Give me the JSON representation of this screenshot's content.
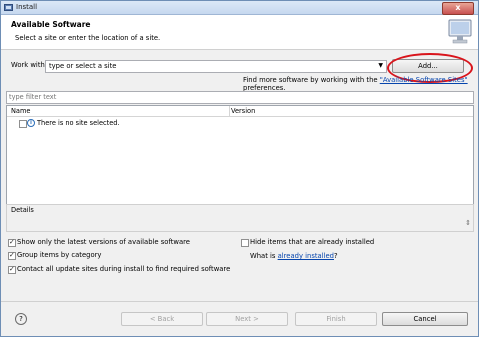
{
  "window": {
    "title": "Install",
    "close_glyph": "x"
  },
  "banner": {
    "heading": "Available Software",
    "subtitle": "Select a site or enter the location of a site."
  },
  "work_with": {
    "label": "Work with:",
    "value": "type or select a site",
    "add_label": "Add...",
    "more_prefix": "Find more software by working with the ",
    "more_link": "\"Available Software Sites\"",
    "more_suffix": " preferences."
  },
  "filter": {
    "placeholder": "type filter text"
  },
  "table": {
    "columns": [
      "Name",
      "Version"
    ],
    "rows": [
      {
        "name": "There is no site selected.",
        "version": ""
      }
    ]
  },
  "details": {
    "label": "Details",
    "scroll_glyph": "⇕"
  },
  "options": {
    "latest_only": {
      "label": "Show only the latest versions of available software",
      "checked": true
    },
    "group_by_category": {
      "label": "Group items by category",
      "checked": true
    },
    "contact_sites": {
      "label": "Contact all update sites during install to find required software",
      "checked": true
    },
    "hide_installed": {
      "label": "Hide items that are already installed",
      "checked": false
    },
    "what_is_prefix": "What is ",
    "what_is_link": "already installed",
    "what_is_suffix": "?"
  },
  "buttons": {
    "help": "?",
    "back": "< Back",
    "next": "Next >",
    "finish": "Finish",
    "cancel": "Cancel"
  },
  "colors": {
    "highlight_ellipse": "#d9141b",
    "link": "#0645ad"
  }
}
